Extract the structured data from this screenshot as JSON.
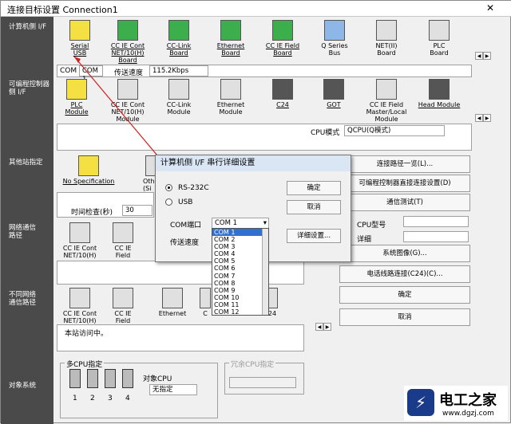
{
  "window": {
    "title": "连接目标设置 Connection1",
    "close_label": "✕"
  },
  "nav": {
    "pc_if": "计算机侧 I/F",
    "plc_if": "可编程控制器侧 I/F",
    "other_station": "其他站指定",
    "network_route": "网络通信路径",
    "diff_network": "不同网络通信路径",
    "target_system": "对象系统"
  },
  "pc_devices": [
    {
      "label": "Serial\nUSB",
      "icon": "serial-usb-icon"
    },
    {
      "label": "CC IE Cont\nNET/10(H)\nBoard",
      "icon": "cc-ie-cont-icon"
    },
    {
      "label": "CC-Link\nBoard",
      "icon": "cc-link-board-icon"
    },
    {
      "label": "Ethernet\nBoard",
      "icon": "ethernet-board-icon"
    },
    {
      "label": "CC IE Field\nBoard",
      "icon": "cc-ie-field-icon"
    },
    {
      "label": "Q Series\nBus",
      "icon": "q-series-bus-icon"
    },
    {
      "label": "NET(II)\nBoard",
      "icon": "net-ii-board-icon"
    },
    {
      "label": "PLC\nBoard",
      "icon": "plc-board-icon"
    }
  ],
  "pc_info": {
    "port": "COM",
    "port_value": "COM 1",
    "speed_label": "传送速度",
    "speed_value": "115.2Kbps"
  },
  "plc_devices": [
    {
      "label": "PLC\nModule"
    },
    {
      "label": "CC IE Cont\nNET/10(H)\nModule"
    },
    {
      "label": "CC-Link\nModule"
    },
    {
      "label": "Ethernet\nModule"
    },
    {
      "label": "C24"
    },
    {
      "label": "GOT"
    },
    {
      "label": "CC IE Field\nMaster/Local\nModule"
    },
    {
      "label": "Head Module"
    }
  ],
  "cpu_mode": {
    "label": "CPU模式",
    "value": "QCPU(Q模式)"
  },
  "other_station": {
    "no_spec": "No Specification",
    "other_partial": "Oth\n(Si",
    "timeout_label": "时间检查(秒)",
    "timeout_value": "30"
  },
  "network_devices": [
    {
      "label": "CC IE Cont\nNET/10(H)"
    },
    {
      "label": "CC IE\nField"
    }
  ],
  "diff_network_devices": [
    {
      "label": "CC IE Cont\nNET/10(H)"
    },
    {
      "label": "CC IE\nField"
    },
    {
      "label": "Ethernet"
    },
    {
      "label": "C"
    },
    {
      "label": "24"
    }
  ],
  "status_text": "本站访问中。",
  "multi_cpu": {
    "label": "多CPU指定",
    "cpus": [
      "1",
      "2",
      "3",
      "4"
    ],
    "target_label": "对象CPU",
    "target_value": "无指定"
  },
  "redundant": {
    "label": "冗余CPU指定"
  },
  "right_buttons": {
    "route_list": "连接路径一览(L)...",
    "direct_connect": "可编程控制器直接连接设置(D)",
    "comm_test": "通信测试(T)",
    "cpu_model_label": "CPU型号",
    "detail_label": "详细",
    "system_image": "系统图像(G)...",
    "phone_line": "电话线路连接(C24)(C)...",
    "ok": "确定",
    "cancel": "取消"
  },
  "dialog": {
    "title": "计算机侧 I/F 串行详细设置",
    "rs232": "RS-232C",
    "usb": "USB",
    "ok": "确定",
    "cancel": "取消",
    "com_label": "COM端口",
    "com_value": "COM 1",
    "speed_label": "传送速度",
    "detail_button": "详细设置...",
    "com_options": [
      "COM 1",
      "COM 2",
      "COM 3",
      "COM 4",
      "COM 5",
      "COM 6",
      "COM 7",
      "COM 8",
      "COM 9",
      "COM 10",
      "COM 11",
      "COM 12"
    ]
  },
  "watermark": {
    "brand": "电工之家",
    "url": "www.dgzj.com"
  }
}
